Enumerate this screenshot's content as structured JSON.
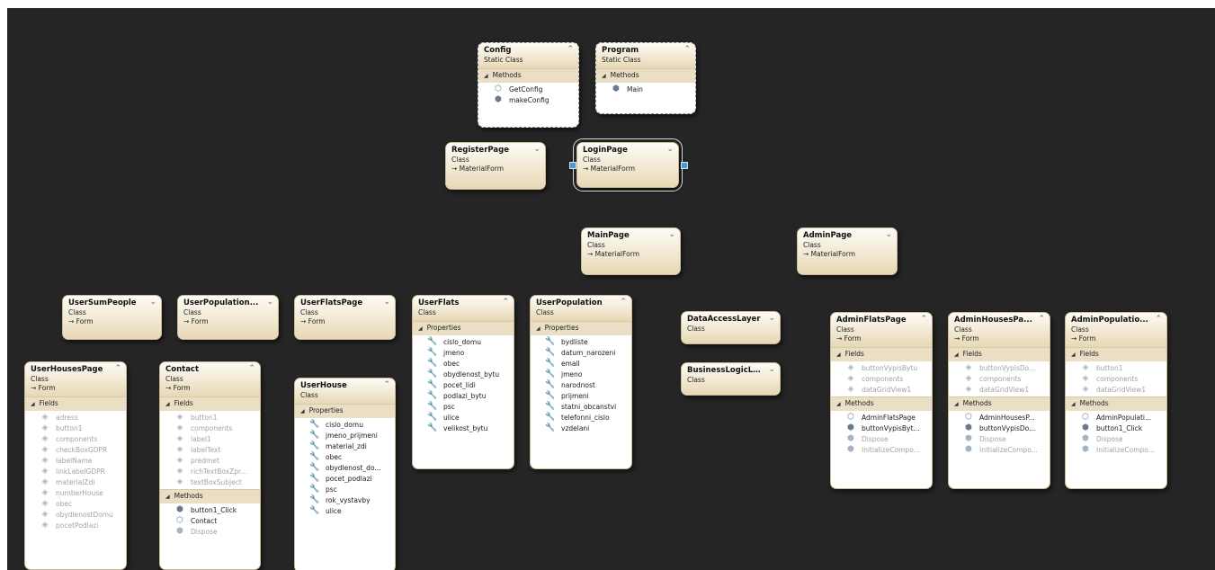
{
  "shapes": [
    {
      "id": "config",
      "name": "Config",
      "kind": "Static Class",
      "static": true,
      "toggle": "⌃",
      "sections": [
        {
          "label": "Methods",
          "members": [
            {
              "text": "GetConfig",
              "icon": "method-icon"
            },
            {
              "text": "makeConfig",
              "icon": "private-method-icon"
            }
          ]
        }
      ]
    },
    {
      "id": "program",
      "name": "Program",
      "kind": "Static Class",
      "static": true,
      "toggle": "⌃",
      "sections": [
        {
          "label": "Methods",
          "members": [
            {
              "text": "Main",
              "icon": "private-method-icon"
            }
          ]
        }
      ]
    },
    {
      "id": "register",
      "name": "RegisterPage",
      "kind": "Class",
      "inherits": "MaterialForm",
      "toggle": "⌄"
    },
    {
      "id": "login",
      "name": "LoginPage",
      "kind": "Class",
      "inherits": "MaterialForm",
      "toggle": "⌄",
      "selected": true
    },
    {
      "id": "main",
      "name": "MainPage",
      "kind": "Class",
      "inherits": "MaterialForm",
      "toggle": "⌄"
    },
    {
      "id": "admin",
      "name": "AdminPage",
      "kind": "Class",
      "inherits": "MaterialForm",
      "toggle": "⌄"
    },
    {
      "id": "usersum",
      "name": "UserSumPeople",
      "kind": "Class",
      "inherits": "Form",
      "toggle": "⌄"
    },
    {
      "id": "userpop",
      "name": "UserPopulation...",
      "kind": "Class",
      "inherits": "Form",
      "toggle": "⌄"
    },
    {
      "id": "userflatspage",
      "name": "UserFlatsPage",
      "kind": "Class",
      "inherits": "Form",
      "toggle": "⌄"
    },
    {
      "id": "userflats",
      "name": "UserFlats",
      "kind": "Class",
      "toggle": "⌃",
      "sections": [
        {
          "label": "Properties",
          "members": [
            {
              "text": "cislo_domu",
              "icon": "wrench-icon"
            },
            {
              "text": "jmeno",
              "icon": "wrench-icon"
            },
            {
              "text": "obec",
              "icon": "wrench-icon"
            },
            {
              "text": "obydlenost_bytu",
              "icon": "wrench-icon"
            },
            {
              "text": "pocet_lidi",
              "icon": "wrench-icon"
            },
            {
              "text": "podlazi_bytu",
              "icon": "wrench-icon"
            },
            {
              "text": "psc",
              "icon": "wrench-icon"
            },
            {
              "text": "ulice",
              "icon": "wrench-icon"
            },
            {
              "text": "velikost_bytu",
              "icon": "wrench-icon"
            }
          ]
        }
      ]
    },
    {
      "id": "userpopulation",
      "name": "UserPopulation",
      "kind": "Class",
      "toggle": "⌃",
      "sections": [
        {
          "label": "Properties",
          "members": [
            {
              "text": "bydliste",
              "icon": "wrench-icon"
            },
            {
              "text": "datum_narozeni",
              "icon": "wrench-icon"
            },
            {
              "text": "email",
              "icon": "wrench-icon"
            },
            {
              "text": "jmeno",
              "icon": "wrench-icon"
            },
            {
              "text": "narodnost",
              "icon": "wrench-icon"
            },
            {
              "text": "prijmeni",
              "icon": "wrench-icon"
            },
            {
              "text": "statni_obcanstvi",
              "icon": "wrench-icon"
            },
            {
              "text": "telefonni_cislo",
              "icon": "wrench-icon"
            },
            {
              "text": "vzdelani",
              "icon": "wrench-icon"
            }
          ]
        }
      ]
    },
    {
      "id": "dal",
      "name": "DataAccessLayer",
      "kind": "Class",
      "toggle": "⌄"
    },
    {
      "id": "bll",
      "name": "BusinessLogicLa...",
      "kind": "Class",
      "toggle": "⌄"
    },
    {
      "id": "adminflats",
      "name": "AdminFlatsPage",
      "kind": "Class",
      "inherits": "Form",
      "toggle": "⌃",
      "sections": [
        {
          "label": "Fields",
          "members": [
            {
              "text": "buttonVypisBytu",
              "icon": "field-icon",
              "faded": true
            },
            {
              "text": "components",
              "icon": "field-icon",
              "faded": true
            },
            {
              "text": "dataGridView1",
              "icon": "field-icon",
              "faded": true
            }
          ]
        },
        {
          "label": "Methods",
          "members": [
            {
              "text": "AdminFlatsPage",
              "icon": "method-icon"
            },
            {
              "text": "buttonVypisByt...",
              "icon": "private-method-icon"
            },
            {
              "text": "Dispose",
              "icon": "private-method-icon",
              "faded": true
            },
            {
              "text": "InitializeCompo...",
              "icon": "private-method-icon",
              "faded": true
            }
          ]
        }
      ]
    },
    {
      "id": "adminhouses",
      "name": "AdminHousesPa...",
      "kind": "Class",
      "inherits": "Form",
      "toggle": "⌃",
      "sections": [
        {
          "label": "Fields",
          "members": [
            {
              "text": "buttonVypisDo...",
              "icon": "field-icon",
              "faded": true
            },
            {
              "text": "components",
              "icon": "field-icon",
              "faded": true
            },
            {
              "text": "dataGridView1",
              "icon": "field-icon",
              "faded": true
            }
          ]
        },
        {
          "label": "Methods",
          "members": [
            {
              "text": "AdminHousesP...",
              "icon": "method-icon"
            },
            {
              "text": "buttonVypisDo...",
              "icon": "private-method-icon"
            },
            {
              "text": "Dispose",
              "icon": "private-method-icon",
              "faded": true
            },
            {
              "text": "InitializeCompo...",
              "icon": "private-method-icon",
              "faded": true
            }
          ]
        }
      ]
    },
    {
      "id": "adminpop",
      "name": "AdminPopulatio...",
      "kind": "Class",
      "inherits": "Form",
      "toggle": "⌃",
      "sections": [
        {
          "label": "Fields",
          "members": [
            {
              "text": "button1",
              "icon": "field-icon",
              "faded": true
            },
            {
              "text": "components",
              "icon": "field-icon",
              "faded": true
            },
            {
              "text": "dataGridView1",
              "icon": "field-icon",
              "faded": true
            }
          ]
        },
        {
          "label": "Methods",
          "members": [
            {
              "text": "AdminPopulati...",
              "icon": "method-icon"
            },
            {
              "text": "button1_Click",
              "icon": "private-method-icon"
            },
            {
              "text": "Dispose",
              "icon": "private-method-icon",
              "faded": true
            },
            {
              "text": "InitializeCompo...",
              "icon": "private-method-icon",
              "faded": true
            }
          ]
        }
      ]
    },
    {
      "id": "userhouses",
      "name": "UserHousesPage",
      "kind": "Class",
      "inherits": "Form",
      "toggle": "⌃",
      "sections": [
        {
          "label": "Fields",
          "members": [
            {
              "text": "adress",
              "icon": "field-icon",
              "faded": true
            },
            {
              "text": "button1",
              "icon": "field-icon",
              "faded": true
            },
            {
              "text": "components",
              "icon": "field-icon",
              "faded": true
            },
            {
              "text": "checkBoxGDPR",
              "icon": "field-icon",
              "faded": true
            },
            {
              "text": "labelName",
              "icon": "field-icon",
              "faded": true
            },
            {
              "text": "linkLabelGDPR",
              "icon": "field-icon",
              "faded": true
            },
            {
              "text": "materialZdi",
              "icon": "field-icon",
              "faded": true
            },
            {
              "text": "numberHouse",
              "icon": "field-icon",
              "faded": true
            },
            {
              "text": "obec",
              "icon": "field-icon",
              "faded": true
            },
            {
              "text": "obydlenostDomu",
              "icon": "field-icon",
              "faded": true
            },
            {
              "text": "pocetPodlazi",
              "icon": "field-icon",
              "faded": true
            }
          ]
        }
      ]
    },
    {
      "id": "contact",
      "name": "Contact",
      "kind": "Class",
      "inherits": "Form",
      "toggle": "⌃",
      "sections": [
        {
          "label": "Fields",
          "members": [
            {
              "text": "button1",
              "icon": "field-icon",
              "faded": true
            },
            {
              "text": "components",
              "icon": "field-icon",
              "faded": true
            },
            {
              "text": "label1",
              "icon": "field-icon",
              "faded": true
            },
            {
              "text": "labelText",
              "icon": "field-icon",
              "faded": true
            },
            {
              "text": "predmet",
              "icon": "field-icon",
              "faded": true
            },
            {
              "text": "richTextBoxZpr...",
              "icon": "field-icon",
              "faded": true
            },
            {
              "text": "textBoxSubject",
              "icon": "field-icon",
              "faded": true
            }
          ]
        },
        {
          "label": "Methods",
          "members": [
            {
              "text": "button1_Click",
              "icon": "private-method-icon"
            },
            {
              "text": "Contact",
              "icon": "method-icon"
            },
            {
              "text": "Dispose",
              "icon": "private-method-icon",
              "faded": true
            }
          ]
        }
      ]
    },
    {
      "id": "userhouse",
      "name": "UserHouse",
      "kind": "Class",
      "toggle": "⌃",
      "sections": [
        {
          "label": "Properties",
          "members": [
            {
              "text": "cislo_domu",
              "icon": "wrench-icon"
            },
            {
              "text": "jmeno_prijmeni",
              "icon": "wrench-icon"
            },
            {
              "text": "material_zdi",
              "icon": "wrench-icon"
            },
            {
              "text": "obec",
              "icon": "wrench-icon"
            },
            {
              "text": "obydlenost_do...",
              "icon": "wrench-icon"
            },
            {
              "text": "pocet_podlazi",
              "icon": "wrench-icon"
            },
            {
              "text": "psc",
              "icon": "wrench-icon"
            },
            {
              "text": "rok_vystavby",
              "icon": "wrench-icon"
            },
            {
              "text": "ulice",
              "icon": "wrench-icon"
            }
          ]
        }
      ]
    }
  ],
  "colors": {
    "canvas": "#252526",
    "header": "#f2e9d3",
    "section": "#eadfc4",
    "selection_handle": "#4a9bd6"
  }
}
